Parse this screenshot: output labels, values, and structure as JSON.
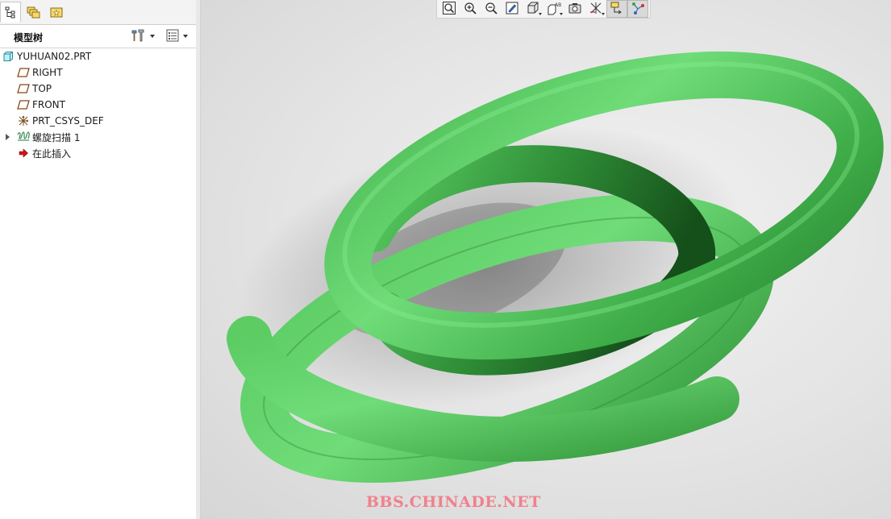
{
  "panel": {
    "title": "模型树",
    "tabs": [
      {
        "name": "model-tree-tab",
        "icon": "tree-icon",
        "active": true
      },
      {
        "name": "folder-browser-tab",
        "icon": "folders-icon",
        "active": false
      },
      {
        "name": "favorites-tab",
        "icon": "favorites-folder-icon",
        "active": false
      }
    ],
    "header_buttons": [
      {
        "name": "settings-button",
        "icon": "tools-icon"
      },
      {
        "name": "show-button",
        "icon": "list-icon"
      }
    ]
  },
  "tree": {
    "items": [
      {
        "label": "YUHUAN02.PRT",
        "icon": "part-icon",
        "level": 0,
        "expandable": false
      },
      {
        "label": "RIGHT",
        "icon": "datum-plane-icon",
        "level": 1,
        "expandable": false
      },
      {
        "label": "TOP",
        "icon": "datum-plane-icon",
        "level": 1,
        "expandable": false
      },
      {
        "label": "FRONT",
        "icon": "datum-plane-icon",
        "level": 1,
        "expandable": false
      },
      {
        "label": "PRT_CSYS_DEF",
        "icon": "coordinate-system-icon",
        "level": 1,
        "expandable": false
      },
      {
        "label": "螺旋扫描 1",
        "icon": "helical-sweep-icon",
        "level": 1,
        "expandable": true
      },
      {
        "label": "在此插入",
        "icon": "insert-here-arrow-icon",
        "level": 1,
        "expandable": false
      }
    ]
  },
  "toolbar": {
    "buttons": [
      {
        "name": "refit-button",
        "icon": "zoom-fit-icon"
      },
      {
        "name": "zoom-in-button",
        "icon": "zoom-in-icon"
      },
      {
        "name": "zoom-out-button",
        "icon": "zoom-out-icon"
      },
      {
        "name": "repaint-button",
        "icon": "repaint-icon"
      },
      {
        "name": "display-style-button",
        "icon": "shaded-cube-icon"
      },
      {
        "name": "saved-views-button",
        "icon": "saved-views-icon"
      },
      {
        "name": "view-manager-button",
        "icon": "camera-icon"
      },
      {
        "name": "datum-display-button",
        "icon": "datum-display-icon"
      },
      {
        "name": "annotation-display-button",
        "icon": "annotation-display-icon"
      },
      {
        "name": "spin-center-button",
        "icon": "spin-center-icon"
      }
    ]
  },
  "watermark": {
    "text": "BBS.CHINADE.NET"
  },
  "colors": {
    "model_green": "#5fd46a",
    "model_green_dark": "#1f6a26",
    "watermark": "#f0818d"
  }
}
